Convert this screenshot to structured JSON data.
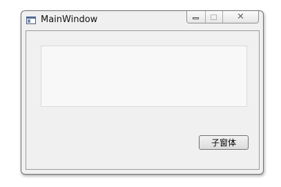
{
  "window": {
    "title": "MainWindow"
  },
  "titlebar_buttons": {
    "minimize_icon": "minimize-icon",
    "maximize_icon": "maximize-icon",
    "close_icon": "close-icon",
    "close_glyph": "✕"
  },
  "central": {
    "text_area_value": "",
    "child_button_label": "子窗体"
  }
}
